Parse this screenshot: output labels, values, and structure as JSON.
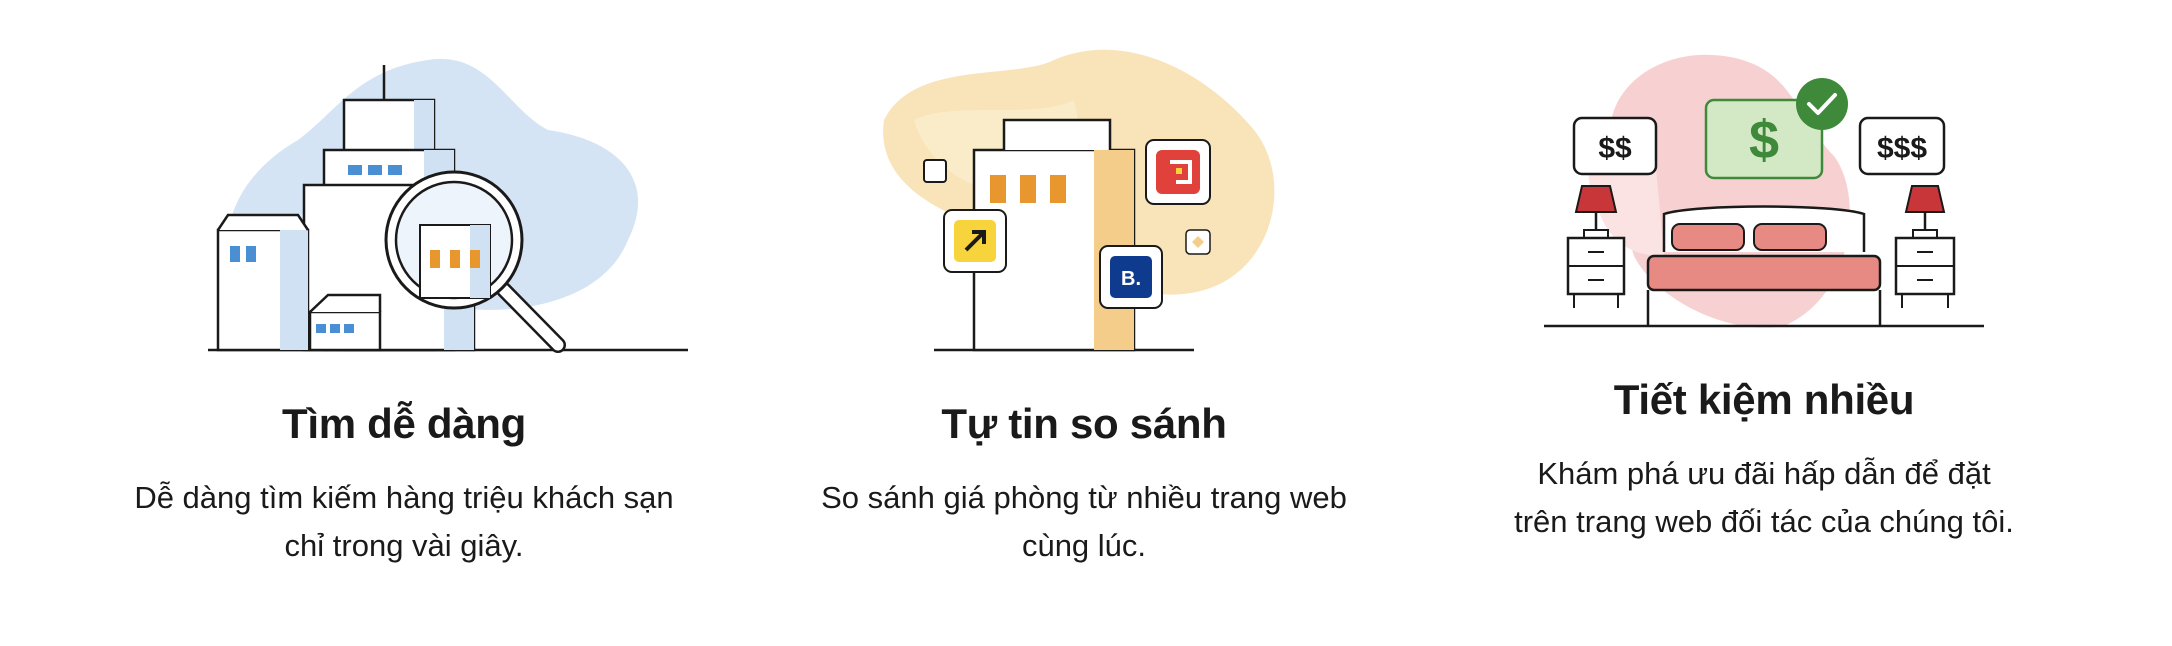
{
  "features": [
    {
      "icon": "city-search-illustration",
      "title": "Tìm dễ dàng",
      "description": "Dễ dàng tìm kiếm hàng triệu khách sạn chỉ trong vài giây."
    },
    {
      "icon": "compare-websites-illustration",
      "title": "Tự tin so sánh",
      "description": "So sánh giá phòng từ nhiều trang web cùng lúc."
    },
    {
      "icon": "save-money-bedroom-illustration",
      "title": "Tiết kiệm nhiều",
      "description": "Khám phá ưu đãi hấp dẫn để đặt trên trang web đối tác của chúng tôi."
    }
  ],
  "badges": {
    "booking_letter": "B.",
    "price_low": "$$",
    "price_mid": "$",
    "price_high": "$$$"
  },
  "colors": {
    "blue_accent": "#4a8fd4",
    "orange_accent": "#e8972e",
    "red_accent": "#e88a84",
    "green_accent": "#3f8a3a"
  }
}
